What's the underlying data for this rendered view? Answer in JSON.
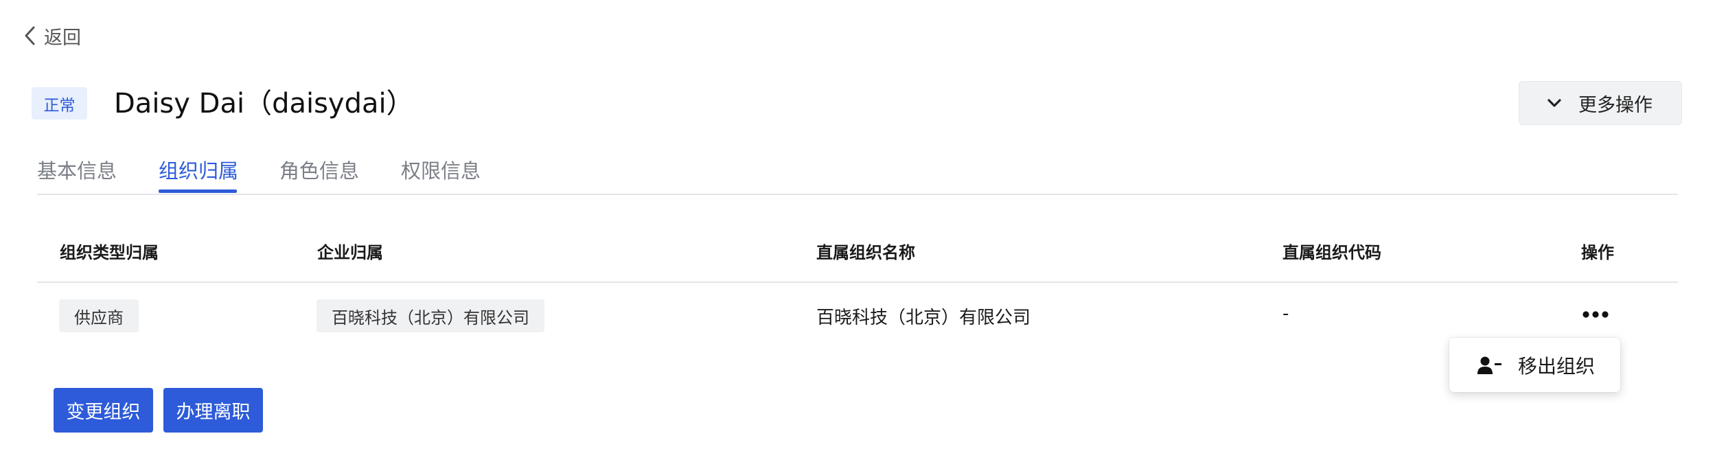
{
  "back": {
    "label": "返回"
  },
  "header": {
    "status": "正常",
    "title": "Daisy Dai（daisydai）",
    "more_actions_label": "更多操作"
  },
  "tabs": [
    {
      "label": "基本信息",
      "active": false
    },
    {
      "label": "组织归属",
      "active": true
    },
    {
      "label": "角色信息",
      "active": false
    },
    {
      "label": "权限信息",
      "active": false
    }
  ],
  "table": {
    "columns": [
      "组织类型归属",
      "企业归属",
      "直属组织名称",
      "直属组织代码",
      "操作"
    ],
    "rows": [
      {
        "org_type": "供应商",
        "enterprise": "百晓科技（北京）有限公司",
        "direct_org_name": "百晓科技（北京）有限公司",
        "direct_org_code": "-",
        "action_icon": "more-horizontal-icon"
      }
    ]
  },
  "row_menu": {
    "items": [
      {
        "label": "移出组织",
        "icon": "user-remove-icon"
      }
    ]
  },
  "buttons": {
    "change_org": "变更组织",
    "resign": "办理离职"
  },
  "colors": {
    "primary": "#2d5bd9",
    "status_bg": "#e8effd",
    "tag_bg": "#f0f1f3"
  }
}
